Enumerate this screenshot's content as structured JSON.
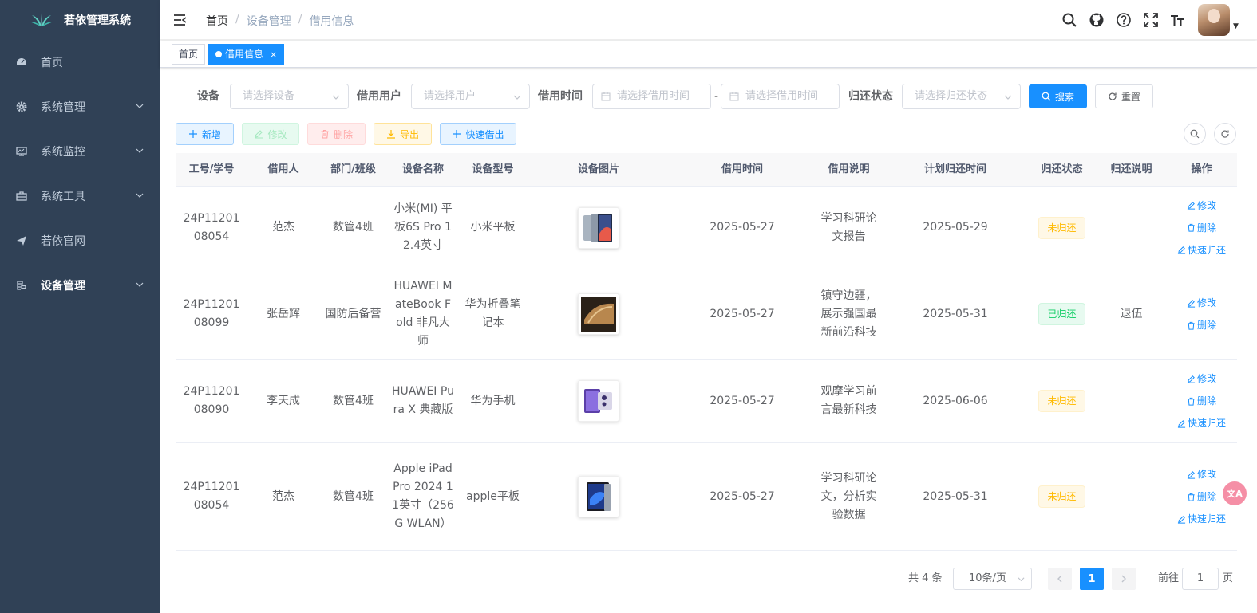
{
  "app": {
    "title": "若依管理系统"
  },
  "sidebar": {
    "items": [
      {
        "label": "首页"
      },
      {
        "label": "系统管理"
      },
      {
        "label": "系统监控"
      },
      {
        "label": "系统工具"
      },
      {
        "label": "若依官网"
      },
      {
        "label": "设备管理"
      }
    ]
  },
  "breadcrumb": [
    "首页",
    "设备管理",
    "借用信息"
  ],
  "tags": {
    "home": "首页",
    "active": "借用信息",
    "close": "×"
  },
  "search_form": {
    "device_label": "设备",
    "device_placeholder": "请选择设备",
    "user_label": "借用用户",
    "user_placeholder": "请选择用户",
    "time_label": "借用时间",
    "time_start_placeholder": "请选择借用时间",
    "time_sep": "-",
    "time_end_placeholder": "请选择借用时间",
    "status_label": "归还状态",
    "status_placeholder": "请选择归还状态",
    "search_btn": "搜索",
    "reset_btn": "重置"
  },
  "toolbar": {
    "add": "新增",
    "edit": "修改",
    "delete": "删除",
    "export": "导出",
    "quick_borrow": "快速借出"
  },
  "table": {
    "columns": [
      "工号/学号",
      "借用人",
      "部门/班级",
      "设备名称",
      "设备型号",
      "设备图片",
      "借用时间",
      "借用说明",
      "计划归还时间",
      "归还状态",
      "归还说明",
      "操作"
    ],
    "rows": [
      {
        "id": "24P1120108054",
        "name": "范杰",
        "dept": "数管4班",
        "device": "小米(MI) 平板6S Pro 12.4英寸",
        "model": "小米平板",
        "image": "tablet-silver",
        "borrow_time": "2025-05-27",
        "note": "学习科研论文报告",
        "plan_return": "2025-05-29",
        "status": "未归还",
        "returned": false,
        "return_note": "",
        "ops": [
          "修改",
          "删除",
          "快速归还"
        ]
      },
      {
        "id": "24P1120108099",
        "name": "张岳辉",
        "dept": "国防后备营",
        "device": "HUAWEI MateBook Fold 非凡大师",
        "model": "华为折叠笔记本",
        "image": "foldable-laptop",
        "borrow_time": "2025-05-27",
        "note": "镇守边疆，展示强国最新前沿科技",
        "plan_return": "2025-05-31",
        "status": "已归还",
        "returned": true,
        "return_note": "退伍",
        "ops": [
          "修改",
          "删除"
        ]
      },
      {
        "id": "24P1120108090",
        "name": "李天成",
        "dept": "数管4班",
        "device": "HUAWEI Pura X 典藏版",
        "model": "华为手机",
        "image": "phone-purple",
        "borrow_time": "2025-05-27",
        "note": "观摩学习前言最新科技",
        "plan_return": "2025-06-06",
        "status": "未归还",
        "returned": false,
        "return_note": "",
        "ops": [
          "修改",
          "删除",
          "快速归还"
        ]
      },
      {
        "id": "24P1120108054",
        "name": "范杰",
        "dept": "数管4班",
        "device": "Apple iPad Pro 2024 11英寸（256G WLAN）",
        "model": "apple平板",
        "image": "ipad-dark",
        "borrow_time": "2025-05-27",
        "note": "学习科研论文，分析实验数据",
        "plan_return": "2025-05-31",
        "status": "未归还",
        "returned": false,
        "return_note": "",
        "ops": [
          "修改",
          "删除",
          "快速归还"
        ]
      }
    ]
  },
  "pagination": {
    "total": "共 4 条",
    "page_size": "10条/页",
    "current_page": "1",
    "goto_label": "前往",
    "goto_value": "1",
    "page_suffix": "页"
  },
  "colors": {
    "sidebar_bg": "#304156",
    "primary": "#1890ff",
    "warning": "#ffba00",
    "success": "#13ce66"
  }
}
